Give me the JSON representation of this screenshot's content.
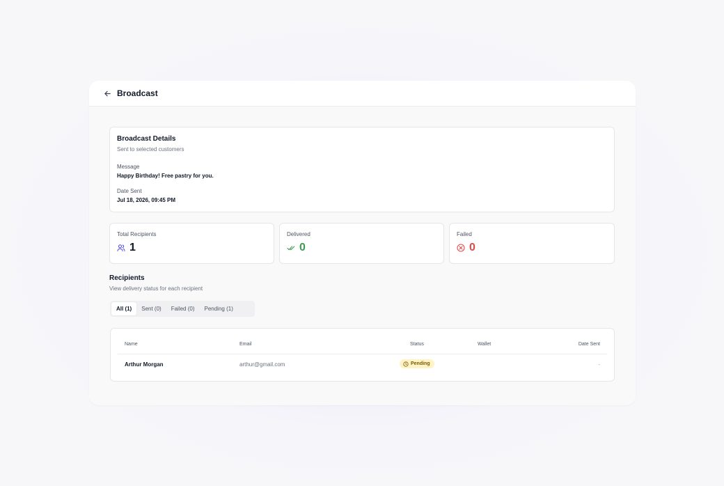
{
  "header": {
    "title": "Broadcast",
    "back_icon": "arrow-left-icon"
  },
  "details": {
    "title": "Broadcast Details",
    "subtitle": "Sent to selected customers",
    "message_label": "Message",
    "message_value": "Happy Birthday! Free pastry for you.",
    "date_label": "Date Sent",
    "date_value": "Jul 18, 2026, 09:45 PM"
  },
  "stats": {
    "total": {
      "label": "Total Recipients",
      "value": "1",
      "icon": "users-icon",
      "color": "#4f46e5"
    },
    "delivered": {
      "label": "Delivered",
      "value": "0",
      "icon": "double-check-icon",
      "color": "#3f9a4e"
    },
    "failed": {
      "label": "Failed",
      "value": "0",
      "icon": "x-circle-icon",
      "color": "#dc4a4a"
    }
  },
  "recipients": {
    "title": "Recipients",
    "subtitle": "View delivery status for each recipient",
    "tabs": [
      {
        "label": "All (1)",
        "active": true
      },
      {
        "label": "Sent (0)",
        "active": false
      },
      {
        "label": "Failed (0)",
        "active": false
      },
      {
        "label": "Pending (1)",
        "active": false
      }
    ],
    "columns": [
      "Name",
      "Email",
      "Status",
      "Wallet",
      "Date Sent"
    ],
    "rows": [
      {
        "name": "Arthur Morgan",
        "email": "arthur@gmail.com",
        "status": "Pending",
        "status_icon": "clock-icon",
        "wallet": "",
        "date_sent": "-"
      }
    ]
  }
}
